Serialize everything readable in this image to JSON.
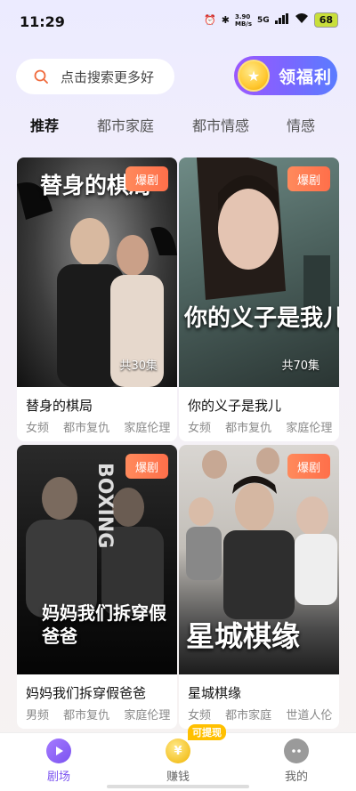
{
  "status_bar": {
    "time": "11:29",
    "net_speed_value": "3.90",
    "net_speed_unit": "MB/s",
    "network": "5G",
    "battery": "68"
  },
  "search": {
    "placeholder": "点击搜索更多好"
  },
  "welfare_button": {
    "label": "领福利"
  },
  "tabs": [
    {
      "label": "推荐",
      "active": true
    },
    {
      "label": "都市家庭"
    },
    {
      "label": "都市情感"
    },
    {
      "label": "情感"
    }
  ],
  "cards": [
    {
      "badge": "爆剧",
      "episodes": "共30集",
      "title": "替身的棋局",
      "tags": [
        "女频",
        "都市复仇",
        "家庭伦理"
      ],
      "poster_text": "替身的棋局"
    },
    {
      "badge": "爆剧",
      "episodes": "共70集",
      "title": "你的义子是我儿",
      "tags": [
        "女频",
        "都市复仇",
        "家庭伦理"
      ],
      "poster_text": "你的义子是我儿"
    },
    {
      "badge": "爆剧",
      "episodes": "",
      "title": "妈妈我们拆穿假爸爸",
      "tags": [
        "男频",
        "都市复仇",
        "家庭伦理"
      ],
      "poster_text": "妈妈我们拆穿假爸爸"
    },
    {
      "badge": "爆剧",
      "episodes": "",
      "title": "星城棋缘",
      "tags": [
        "女频",
        "都市家庭",
        "世道人伦"
      ],
      "poster_text": "星城棋缘"
    }
  ],
  "bottom_nav": {
    "items": [
      {
        "label": "剧场",
        "icon": "play-icon",
        "active": true
      },
      {
        "label": "赚钱",
        "icon": "coin-icon"
      },
      {
        "label": "我的",
        "icon": "profile-icon"
      }
    ],
    "withdraw_tag": "可提现"
  },
  "colors": {
    "accent": "#7b53f0",
    "badge": "#ff7a52",
    "welfare_gradient_start": "#9b59ff",
    "welfare_gradient_end": "#5a7cff"
  }
}
